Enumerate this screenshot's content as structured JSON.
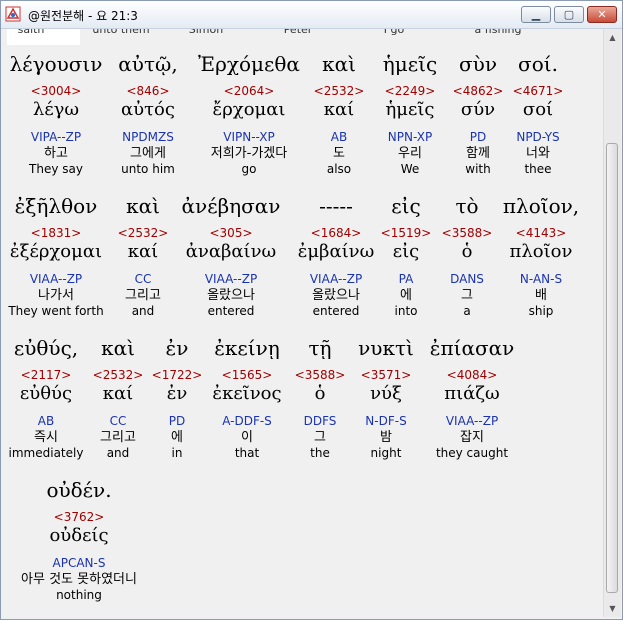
{
  "window": {
    "title": "@원전분해 - 요 21:3"
  },
  "partial_top_row": [
    "saith",
    "unto them",
    "Simon",
    "Peter",
    "I go",
    "a fishing"
  ],
  "rows": [
    [
      {
        "greek": "λέγουσιν",
        "strong": "<3004>",
        "lemma": "λέγω",
        "parse": "VIPA--ZP",
        "korean": "하고",
        "english": "They say"
      },
      {
        "greek": "αὐτῷ,",
        "strong": "<846>",
        "lemma": "αὐτός",
        "parse": "NPDMZS",
        "korean": "그에게",
        "english": "unto him"
      },
      {
        "greek": "Ἐρχόμεθα",
        "strong": "<2064>",
        "lemma": "ἔρχομαι",
        "parse": "VIPN--XP",
        "korean": "저희가-가겠다",
        "english": "go"
      },
      {
        "greek": "καὶ",
        "strong": "<2532>",
        "lemma": "καί",
        "parse": "AB",
        "korean": "도",
        "english": "also"
      },
      {
        "greek": "ἡμεῖς",
        "strong": "<2249>",
        "lemma": "ἡμεῖς",
        "parse": "NPN-XP",
        "korean": "우리",
        "english": "We"
      },
      {
        "greek": "σὺν",
        "strong": "<4862>",
        "lemma": "σύν",
        "parse": "PD",
        "korean": "함께",
        "english": "with"
      },
      {
        "greek": "σοί.",
        "strong": "<4671>",
        "lemma": "σοί",
        "parse": "NPD-YS",
        "korean": "너와",
        "english": "thee"
      }
    ],
    [
      {
        "greek": "ἐξῆλθον",
        "strong": "<1831>",
        "lemma": "ἐξέρχομαι",
        "parse": "VIAA--ZP",
        "korean": "나가서",
        "english": "They went forth"
      },
      {
        "greek": "καὶ",
        "strong": "<2532>",
        "lemma": "καί",
        "parse": "CC",
        "korean": "그리고",
        "english": "and"
      },
      {
        "greek": "ἀνέβησαν",
        "strong": "<305>",
        "lemma": "ἀναβαίνω",
        "parse": "VIAA--ZP",
        "korean": "올랐으나",
        "english": "entered"
      },
      {
        "greek": "-----",
        "strong": "<1684>",
        "lemma": "ἐμβαίνω",
        "parse": "VIAA--ZP",
        "korean": "올랐으나",
        "english": "entered"
      },
      {
        "greek": "εἰς",
        "strong": "<1519>",
        "lemma": "εἰς",
        "parse": "PA",
        "korean": "에",
        "english": "into"
      },
      {
        "greek": "τὸ",
        "strong": "<3588>",
        "lemma": "ὁ",
        "parse": "DANS",
        "korean": "그",
        "english": "a"
      },
      {
        "greek": "πλοῖον,",
        "strong": "<4143>",
        "lemma": "πλοῖον",
        "parse": "N-AN-S",
        "korean": "배",
        "english": "ship"
      }
    ],
    [
      {
        "greek": "εὐθύς,",
        "strong": "<2117>",
        "lemma": "εὐθύς",
        "parse": "AB",
        "korean": "즉시",
        "english": "immediately"
      },
      {
        "greek": "καὶ",
        "strong": "<2532>",
        "lemma": "καί",
        "parse": "CC",
        "korean": "그리고",
        "english": "and"
      },
      {
        "greek": "ἐν",
        "strong": "<1722>",
        "lemma": "ἐν",
        "parse": "PD",
        "korean": "에",
        "english": "in"
      },
      {
        "greek": "ἐκείνῃ",
        "strong": "<1565>",
        "lemma": "ἐκεῖνος",
        "parse": "A-DDF-S",
        "korean": "이",
        "english": "that"
      },
      {
        "greek": "τῇ",
        "strong": "<3588>",
        "lemma": "ὁ",
        "parse": "DDFS",
        "korean": "그",
        "english": "the"
      },
      {
        "greek": "νυκτὶ",
        "strong": "<3571>",
        "lemma": "νύξ",
        "parse": "N-DF-S",
        "korean": "밤",
        "english": "night"
      },
      {
        "greek": "ἐπίασαν",
        "strong": "<4084>",
        "lemma": "πιάζω",
        "parse": "VIAA--ZP",
        "korean": "잡지",
        "english": "they caught"
      }
    ],
    [
      {
        "greek": "οὐδέν.",
        "strong": "<3762>",
        "lemma": "οὐδείς",
        "parse": "APCAN-S",
        "korean": "아무 것도 못하였더니",
        "english": "nothing"
      }
    ]
  ]
}
